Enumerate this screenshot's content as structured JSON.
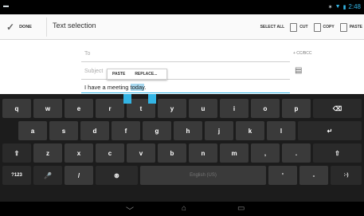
{
  "status": {
    "time": "2:48"
  },
  "actionbar": {
    "done_label": "DONE",
    "title": "Text selection",
    "select_all": "SELECT ALL",
    "cut": "CUT",
    "copy": "COPY",
    "paste": "PASTE"
  },
  "compose": {
    "to_placeholder": "To",
    "cc_bcc": "+ CC/BCC",
    "subject_placeholder": "Subject",
    "body_prefix": "I have a meeting ",
    "body_selected": "today",
    "body_suffix": "."
  },
  "popup": {
    "paste": "PASTE",
    "replace": "REPLACE..."
  },
  "keyboard": {
    "row1": [
      "q",
      "w",
      "e",
      "r",
      "t",
      "y",
      "u",
      "i",
      "o",
      "p",
      "⌫"
    ],
    "row2": [
      "a",
      "s",
      "d",
      "f",
      "g",
      "h",
      "j",
      "k",
      "l",
      "↵"
    ],
    "row3": [
      "⇧",
      "z",
      "x",
      "c",
      "v",
      "b",
      "n",
      "m",
      ",",
      ".",
      "⇧"
    ],
    "row4": {
      "sym": "?123",
      "mic": "🎤",
      "slash": "/",
      "emoji": "⊛",
      "space": "English (US)",
      "apos": "'",
      "dash": "-",
      "smiley": ":-)"
    }
  }
}
